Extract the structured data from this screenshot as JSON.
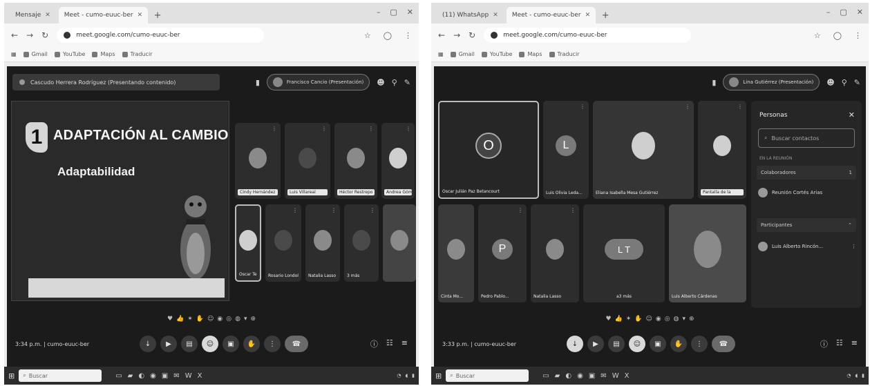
{
  "left": {
    "tabs": [
      {
        "label": "Mensaje",
        "active": false
      },
      {
        "label": "Meet - cumo-euuc-ber",
        "active": true
      }
    ],
    "url": "meet.google.com/cumo-euuc-ber",
    "bookmarks": [
      "Gmail",
      "YouTube",
      "Maps",
      "Traducir"
    ],
    "meeting_title": "Cascudo Herrera Rodríguez (Presentando contenido)",
    "presenter_pill": "Francisco Cancio (Presentación)",
    "slide": {
      "number": "1",
      "title": "ADAPTACIÓN AL CAMBIO",
      "subtitle": "Adaptabilidad"
    },
    "tiles": [
      {
        "name": "Cindy Hernández",
        "boxed": true
      },
      {
        "name": "Luis Villareal",
        "boxed": true
      },
      {
        "name": "Héctor Restrepo",
        "boxed": true
      },
      {
        "name": "Andrea Gómez",
        "boxed": true
      },
      {
        "name": "Oscar Tello",
        "boxed": false
      },
      {
        "name": "Rosario Londoño",
        "boxed": false
      },
      {
        "name": "Natalia Lasso",
        "boxed": false
      },
      {
        "name": "3 más",
        "boxed": false
      }
    ],
    "clock": "3:34 p.m. | cumo-euuc-ber",
    "taskbar_search": "Buscar"
  },
  "right": {
    "tabs": [
      {
        "label": "(11) WhatsApp",
        "active": false
      },
      {
        "label": "Meet - cumo-euuc-ber",
        "active": true
      }
    ],
    "url": "meet.google.com/cumo-euuc-ber",
    "bookmarks": [
      "Gmail",
      "YouTube",
      "Maps",
      "Traducir"
    ],
    "presenter_pill": "Lina Gutiérrez (Presentación)",
    "tiles": [
      {
        "name": "Oscar Julián Paz Betancourt",
        "initial": "O"
      },
      {
        "name": "Luis Olivia Leda...",
        "initial": "L"
      },
      {
        "name": "Eliana Isabella Mesa Gutiérrez",
        "initial": ""
      },
      {
        "name": "Pantalla de la",
        "initial": ""
      },
      {
        "name": "Cinta Mo...",
        "initial": ""
      },
      {
        "name": "Pedro Pablo...",
        "initial": "P"
      },
      {
        "name": "Natalia Lasso",
        "initial": ""
      },
      {
        "name": "a3 más",
        "initial": "L T"
      },
      {
        "name": "Luis Alberto Cárdenas",
        "initial": ""
      }
    ],
    "clock": "3:33 p.m. | cumo-euuc-ber",
    "people_panel": {
      "title": "Personas",
      "search_placeholder": "Buscar contactos",
      "section_label": "EN LA REUNIÓN",
      "group_contributors": "Colaboradores",
      "group_count": "1",
      "host": "Reunión Cortés Arias",
      "participants_label": "Participantes",
      "participant": "Luis Alberto Rincón..."
    },
    "taskbar_search": "Buscar"
  }
}
